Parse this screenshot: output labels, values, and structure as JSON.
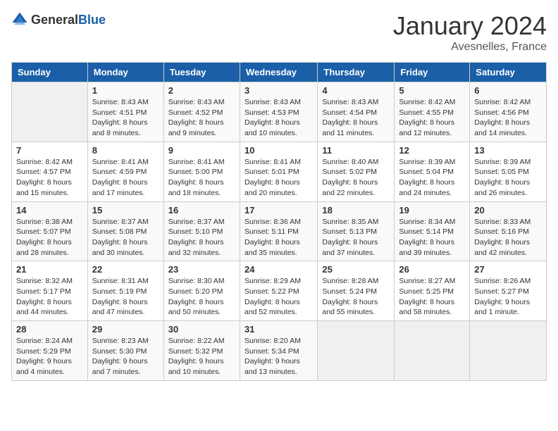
{
  "header": {
    "logo_general": "General",
    "logo_blue": "Blue",
    "month_year": "January 2024",
    "location": "Avesnelles, France"
  },
  "days_of_week": [
    "Sunday",
    "Monday",
    "Tuesday",
    "Wednesday",
    "Thursday",
    "Friday",
    "Saturday"
  ],
  "weeks": [
    [
      {
        "day": "",
        "sunrise": "",
        "sunset": "",
        "daylight": ""
      },
      {
        "day": "1",
        "sunrise": "Sunrise: 8:43 AM",
        "sunset": "Sunset: 4:51 PM",
        "daylight": "Daylight: 8 hours and 8 minutes."
      },
      {
        "day": "2",
        "sunrise": "Sunrise: 8:43 AM",
        "sunset": "Sunset: 4:52 PM",
        "daylight": "Daylight: 8 hours and 9 minutes."
      },
      {
        "day": "3",
        "sunrise": "Sunrise: 8:43 AM",
        "sunset": "Sunset: 4:53 PM",
        "daylight": "Daylight: 8 hours and 10 minutes."
      },
      {
        "day": "4",
        "sunrise": "Sunrise: 8:43 AM",
        "sunset": "Sunset: 4:54 PM",
        "daylight": "Daylight: 8 hours and 11 minutes."
      },
      {
        "day": "5",
        "sunrise": "Sunrise: 8:42 AM",
        "sunset": "Sunset: 4:55 PM",
        "daylight": "Daylight: 8 hours and 12 minutes."
      },
      {
        "day": "6",
        "sunrise": "Sunrise: 8:42 AM",
        "sunset": "Sunset: 4:56 PM",
        "daylight": "Daylight: 8 hours and 14 minutes."
      }
    ],
    [
      {
        "day": "7",
        "sunrise": "Sunrise: 8:42 AM",
        "sunset": "Sunset: 4:57 PM",
        "daylight": "Daylight: 8 hours and 15 minutes."
      },
      {
        "day": "8",
        "sunrise": "Sunrise: 8:41 AM",
        "sunset": "Sunset: 4:59 PM",
        "daylight": "Daylight: 8 hours and 17 minutes."
      },
      {
        "day": "9",
        "sunrise": "Sunrise: 8:41 AM",
        "sunset": "Sunset: 5:00 PM",
        "daylight": "Daylight: 8 hours and 18 minutes."
      },
      {
        "day": "10",
        "sunrise": "Sunrise: 8:41 AM",
        "sunset": "Sunset: 5:01 PM",
        "daylight": "Daylight: 8 hours and 20 minutes."
      },
      {
        "day": "11",
        "sunrise": "Sunrise: 8:40 AM",
        "sunset": "Sunset: 5:02 PM",
        "daylight": "Daylight: 8 hours and 22 minutes."
      },
      {
        "day": "12",
        "sunrise": "Sunrise: 8:39 AM",
        "sunset": "Sunset: 5:04 PM",
        "daylight": "Daylight: 8 hours and 24 minutes."
      },
      {
        "day": "13",
        "sunrise": "Sunrise: 8:39 AM",
        "sunset": "Sunset: 5:05 PM",
        "daylight": "Daylight: 8 hours and 26 minutes."
      }
    ],
    [
      {
        "day": "14",
        "sunrise": "Sunrise: 8:38 AM",
        "sunset": "Sunset: 5:07 PM",
        "daylight": "Daylight: 8 hours and 28 minutes."
      },
      {
        "day": "15",
        "sunrise": "Sunrise: 8:37 AM",
        "sunset": "Sunset: 5:08 PM",
        "daylight": "Daylight: 8 hours and 30 minutes."
      },
      {
        "day": "16",
        "sunrise": "Sunrise: 8:37 AM",
        "sunset": "Sunset: 5:10 PM",
        "daylight": "Daylight: 8 hours and 32 minutes."
      },
      {
        "day": "17",
        "sunrise": "Sunrise: 8:36 AM",
        "sunset": "Sunset: 5:11 PM",
        "daylight": "Daylight: 8 hours and 35 minutes."
      },
      {
        "day": "18",
        "sunrise": "Sunrise: 8:35 AM",
        "sunset": "Sunset: 5:13 PM",
        "daylight": "Daylight: 8 hours and 37 minutes."
      },
      {
        "day": "19",
        "sunrise": "Sunrise: 8:34 AM",
        "sunset": "Sunset: 5:14 PM",
        "daylight": "Daylight: 8 hours and 39 minutes."
      },
      {
        "day": "20",
        "sunrise": "Sunrise: 8:33 AM",
        "sunset": "Sunset: 5:16 PM",
        "daylight": "Daylight: 8 hours and 42 minutes."
      }
    ],
    [
      {
        "day": "21",
        "sunrise": "Sunrise: 8:32 AM",
        "sunset": "Sunset: 5:17 PM",
        "daylight": "Daylight: 8 hours and 44 minutes."
      },
      {
        "day": "22",
        "sunrise": "Sunrise: 8:31 AM",
        "sunset": "Sunset: 5:19 PM",
        "daylight": "Daylight: 8 hours and 47 minutes."
      },
      {
        "day": "23",
        "sunrise": "Sunrise: 8:30 AM",
        "sunset": "Sunset: 5:20 PM",
        "daylight": "Daylight: 8 hours and 50 minutes."
      },
      {
        "day": "24",
        "sunrise": "Sunrise: 8:29 AM",
        "sunset": "Sunset: 5:22 PM",
        "daylight": "Daylight: 8 hours and 52 minutes."
      },
      {
        "day": "25",
        "sunrise": "Sunrise: 8:28 AM",
        "sunset": "Sunset: 5:24 PM",
        "daylight": "Daylight: 8 hours and 55 minutes."
      },
      {
        "day": "26",
        "sunrise": "Sunrise: 8:27 AM",
        "sunset": "Sunset: 5:25 PM",
        "daylight": "Daylight: 8 hours and 58 minutes."
      },
      {
        "day": "27",
        "sunrise": "Sunrise: 8:26 AM",
        "sunset": "Sunset: 5:27 PM",
        "daylight": "Daylight: 9 hours and 1 minute."
      }
    ],
    [
      {
        "day": "28",
        "sunrise": "Sunrise: 8:24 AM",
        "sunset": "Sunset: 5:29 PM",
        "daylight": "Daylight: 9 hours and 4 minutes."
      },
      {
        "day": "29",
        "sunrise": "Sunrise: 8:23 AM",
        "sunset": "Sunset: 5:30 PM",
        "daylight": "Daylight: 9 hours and 7 minutes."
      },
      {
        "day": "30",
        "sunrise": "Sunrise: 8:22 AM",
        "sunset": "Sunset: 5:32 PM",
        "daylight": "Daylight: 9 hours and 10 minutes."
      },
      {
        "day": "31",
        "sunrise": "Sunrise: 8:20 AM",
        "sunset": "Sunset: 5:34 PM",
        "daylight": "Daylight: 9 hours and 13 minutes."
      },
      {
        "day": "",
        "sunrise": "",
        "sunset": "",
        "daylight": ""
      },
      {
        "day": "",
        "sunrise": "",
        "sunset": "",
        "daylight": ""
      },
      {
        "day": "",
        "sunrise": "",
        "sunset": "",
        "daylight": ""
      }
    ]
  ]
}
